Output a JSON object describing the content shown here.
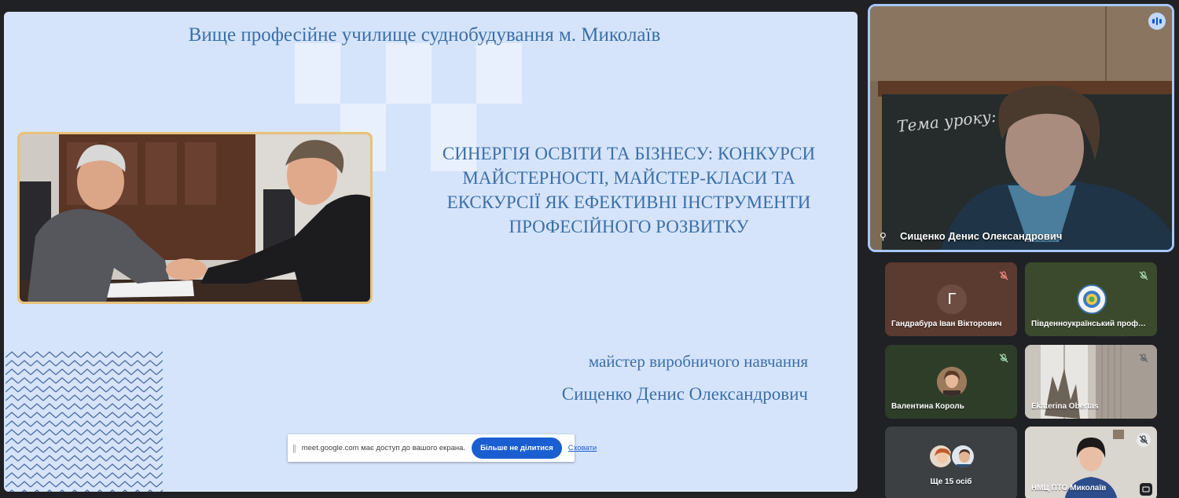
{
  "slide": {
    "header": "Вище професійне училище суднобудування м. Миколаїв",
    "title_lines": [
      "СИНЕРГІЯ ОСВІТИ ТА БІЗНЕСУ: КОНКУРСИ",
      "МАЙСТЕРНОСТІ, МАЙСТЕР-КЛАСИ ТА",
      "ЕКСКУРСІЇ ЯК ЕФЕКТИВНІ ІНСТРУМЕНТИ",
      "ПРОФЕСІЙНОГО РОЗВИТКУ"
    ],
    "role": "майстер виробничого навчання",
    "presenter": "Сищенко Денис Олександрович"
  },
  "share_bar": {
    "message": "meet.google.com має доступ до вашого екрана.",
    "stop_label": "Більше не ділитися",
    "hide_label": "Сховати"
  },
  "speaker": {
    "name": "Сищенко Денис Олександрович",
    "board_text": "Тема уроку:"
  },
  "participants": {
    "p1": {
      "name": "Гандрабура Іван Вікторович",
      "initial": "Г"
    },
    "p2": {
      "name": "Південноукраїнський профес..."
    },
    "p3": {
      "name": "Валентина Король"
    },
    "p4": {
      "name": "Ekaterina Obertas"
    },
    "p5": {
      "name": "Ще 15 осіб"
    },
    "p6": {
      "name": "НМЦ ПТО Миколаїв"
    }
  },
  "colors": {
    "slide_bg": "#d6e4fb",
    "slide_text": "#3b6fa8",
    "accent_blue": "#1a5fd1",
    "tile_brown": "#5b3a2f",
    "tile_green": "#2e3d28",
    "tile_gray": "#3c4043"
  }
}
